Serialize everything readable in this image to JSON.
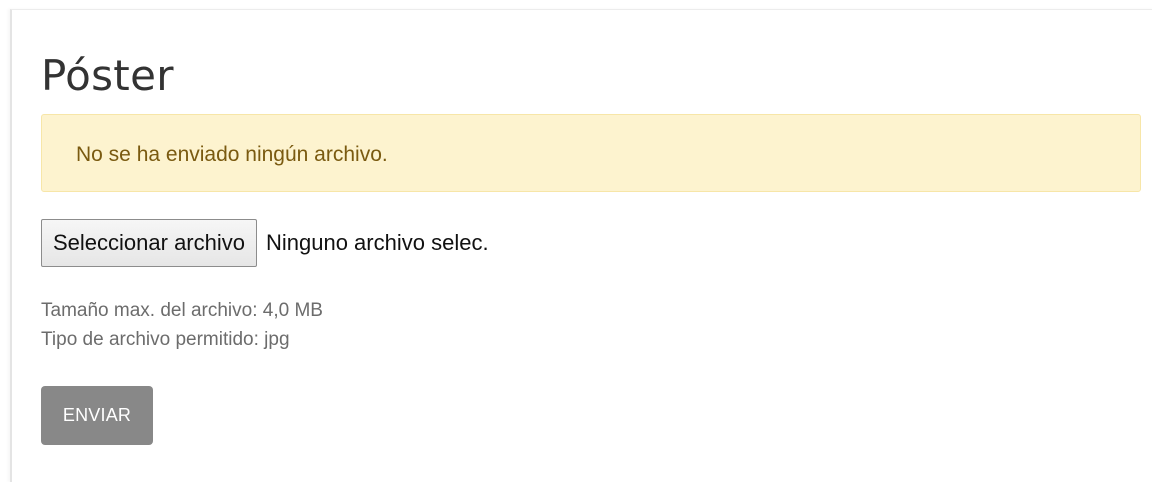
{
  "section": {
    "title": "Póster"
  },
  "alert": {
    "message": "No se ha enviado ningún archivo."
  },
  "file_input": {
    "button_label": "Seleccionar archivo",
    "status_text": "Ninguno archivo selec."
  },
  "help": {
    "max_size": "Tamaño max. del archivo: 4,0 MB",
    "allowed_type": "Tipo de archivo permitido: jpg"
  },
  "form": {
    "submit_label": "ENVIAR"
  },
  "colors": {
    "alert_background": "#fdf3cf",
    "alert_text": "#7a5a10",
    "submit_background": "#888888"
  }
}
